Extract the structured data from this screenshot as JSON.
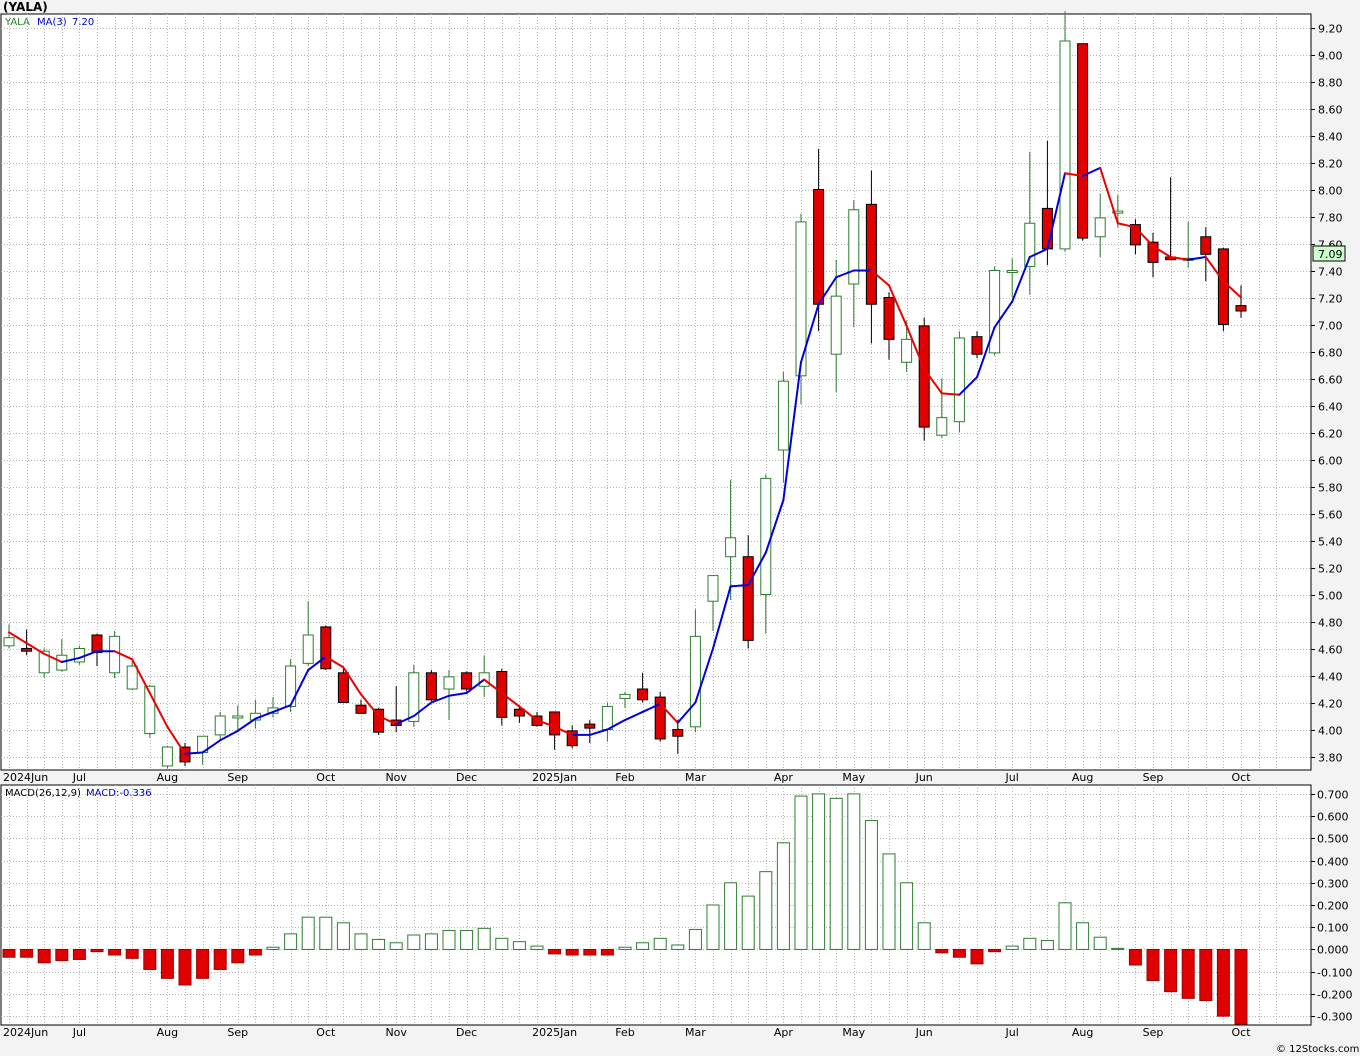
{
  "title": "(YALA)",
  "legend": {
    "symbol": "YALA",
    "ma_label": "MA(3)",
    "ma_value": "7.20",
    "macd_label": "MACD(26,12,9)",
    "macd_value_label": "MACD:-0.336"
  },
  "last_price_label": "7.09",
  "credit": "© 12Stocks.com",
  "colors": {
    "up": "#2e7d32",
    "down": "#e00000",
    "ma_up": "#0000dd",
    "ma_down": "#ee0000",
    "legend_symbol": "#2e7d32",
    "legend_ma": "#0000cc",
    "last_price_box": "#ccffcc"
  },
  "chart_data": [
    {
      "type": "candlestick",
      "title": "(YALA)",
      "ylim": [
        3.7,
        9.3
      ],
      "yticks": [
        3.8,
        4.0,
        4.2,
        4.4,
        4.6,
        4.8,
        5.0,
        5.2,
        5.4,
        5.6,
        5.8,
        6.0,
        6.2,
        6.4,
        6.6,
        6.8,
        7.0,
        7.2,
        7.4,
        7.6,
        7.8,
        8.0,
        8.2,
        8.4,
        8.6,
        8.8,
        9.0,
        9.2
      ],
      "x_labels": [
        "2024Jun",
        "Jul",
        "Aug",
        "Sep",
        "Oct",
        "Nov",
        "Dec",
        "2025Jan",
        "Feb",
        "Mar",
        "Apr",
        "May",
        "Jun",
        "Jul",
        "Aug",
        "Sep",
        "Oct"
      ],
      "x_label_weeks": [
        0,
        4,
        9,
        13,
        18,
        22,
        26,
        31,
        35,
        39,
        44,
        48,
        52,
        57,
        61,
        65,
        70
      ],
      "candles": [
        [
          4.62,
          4.78,
          4.6,
          4.68
        ],
        [
          4.6,
          4.74,
          4.55,
          4.58
        ],
        [
          4.42,
          4.6,
          4.38,
          4.58
        ],
        [
          4.44,
          4.67,
          4.43,
          4.55
        ],
        [
          4.5,
          4.62,
          4.48,
          4.6
        ],
        [
          4.7,
          4.71,
          4.47,
          4.57
        ],
        [
          4.42,
          4.73,
          4.38,
          4.69
        ],
        [
          4.3,
          4.52,
          4.29,
          4.47
        ],
        [
          3.97,
          4.33,
          3.94,
          4.32
        ],
        [
          3.73,
          3.88,
          3.71,
          3.87
        ],
        [
          3.87,
          3.9,
          3.73,
          3.76
        ],
        [
          3.83,
          3.95,
          3.74,
          3.95
        ],
        [
          3.96,
          4.13,
          3.92,
          4.1
        ],
        [
          4.1,
          4.18,
          3.99,
          4.1
        ],
        [
          4.07,
          4.22,
          4.01,
          4.12
        ],
        [
          4.12,
          4.24,
          4.09,
          4.16
        ],
        [
          4.17,
          4.52,
          4.13,
          4.47
        ],
        [
          4.49,
          4.95,
          4.47,
          4.7
        ],
        [
          4.76,
          4.77,
          4.44,
          4.45
        ],
        [
          4.42,
          4.45,
          4.22,
          4.2
        ],
        [
          4.18,
          4.22,
          4.12,
          4.12
        ],
        [
          4.15,
          4.16,
          3.96,
          3.98
        ],
        [
          4.07,
          4.32,
          3.98,
          4.03
        ],
        [
          4.06,
          4.48,
          4.02,
          4.42
        ],
        [
          4.42,
          4.44,
          4.21,
          4.22
        ],
        [
          4.3,
          4.44,
          4.07,
          4.39
        ],
        [
          4.42,
          4.43,
          4.28,
          4.3
        ],
        [
          4.32,
          4.55,
          4.24,
          4.42
        ],
        [
          4.43,
          4.45,
          4.03,
          4.09
        ],
        [
          4.15,
          4.18,
          4.05,
          4.1
        ],
        [
          4.1,
          4.13,
          4.02,
          4.03
        ],
        [
          4.13,
          4.13,
          3.85,
          3.96
        ],
        [
          3.99,
          4.03,
          3.86,
          3.88
        ],
        [
          4.04,
          4.07,
          3.9,
          4.01
        ],
        [
          4.0,
          4.2,
          3.91,
          4.17
        ],
        [
          4.23,
          4.28,
          4.16,
          4.26
        ],
        [
          4.3,
          4.42,
          4.2,
          4.22
        ],
        [
          4.24,
          4.28,
          3.91,
          3.93
        ],
        [
          4.0,
          4.07,
          3.82,
          3.95
        ],
        [
          4.02,
          4.89,
          3.98,
          4.69
        ],
        [
          4.95,
          5.13,
          4.73,
          5.14
        ],
        [
          5.28,
          5.85,
          4.96,
          5.42
        ],
        [
          5.28,
          5.44,
          4.6,
          4.66
        ],
        [
          5.0,
          5.89,
          4.71,
          5.86
        ],
        [
          6.07,
          6.65,
          5.83,
          6.58
        ],
        [
          6.62,
          7.82,
          6.41,
          7.76
        ],
        [
          8.0,
          8.3,
          6.95,
          7.15
        ],
        [
          6.78,
          7.48,
          6.5,
          7.21
        ],
        [
          7.3,
          7.92,
          6.98,
          7.85
        ],
        [
          7.89,
          8.14,
          6.86,
          7.15
        ],
        [
          7.2,
          7.24,
          6.74,
          6.89
        ],
        [
          6.72,
          7.03,
          6.65,
          6.89
        ],
        [
          6.99,
          7.05,
          6.14,
          6.24
        ],
        [
          6.18,
          6.6,
          6.16,
          6.31
        ],
        [
          6.28,
          6.95,
          6.2,
          6.9
        ],
        [
          6.91,
          6.95,
          6.75,
          6.78
        ],
        [
          6.79,
          7.43,
          6.77,
          7.4
        ],
        [
          7.39,
          7.49,
          7.2,
          7.4
        ],
        [
          7.43,
          8.28,
          7.22,
          7.75
        ],
        [
          7.86,
          8.36,
          7.44,
          7.56
        ],
        [
          7.56,
          9.32,
          7.54,
          9.1
        ],
        [
          9.08,
          9.08,
          7.62,
          7.64
        ],
        [
          7.65,
          7.97,
          7.5,
          7.79
        ],
        [
          7.84,
          7.96,
          7.72,
          7.84
        ],
        [
          7.74,
          7.78,
          7.52,
          7.59
        ],
        [
          7.61,
          7.68,
          7.35,
          7.46
        ],
        [
          7.5,
          8.09,
          7.48,
          7.48
        ],
        [
          7.49,
          7.76,
          7.42,
          7.49
        ],
        [
          7.65,
          7.72,
          7.32,
          7.52
        ],
        [
          7.56,
          7.57,
          6.95,
          7.0
        ],
        [
          7.14,
          7.29,
          7.05,
          7.1
        ]
      ],
      "ma3": [
        4.72,
        4.64,
        4.56,
        4.5,
        4.53,
        4.58,
        4.58,
        4.52,
        4.27,
        4.02,
        3.82,
        3.83,
        3.92,
        3.99,
        4.08,
        4.13,
        4.18,
        4.44,
        4.54,
        4.46,
        4.26,
        4.1,
        4.04,
        4.1,
        4.2,
        4.25,
        4.27,
        4.37,
        4.27,
        4.17,
        4.07,
        4.02,
        3.96,
        3.96,
        4.0,
        4.07,
        4.13,
        4.19,
        4.05,
        4.2,
        4.6,
        5.06,
        5.07,
        5.31,
        5.7,
        6.72,
        7.15,
        7.35,
        7.4,
        7.4,
        7.29,
        6.99,
        6.67,
        6.49,
        6.48,
        6.61,
        6.98,
        7.17,
        7.5,
        7.56,
        8.12,
        8.1,
        8.16,
        7.75,
        7.72,
        7.58,
        7.5,
        7.48,
        7.5,
        7.32,
        7.2
      ]
    },
    {
      "type": "bar",
      "title": "MACD(26,12,9)",
      "ylim": [
        -0.34,
        0.74
      ],
      "yticks": [
        -0.3,
        -0.2,
        -0.1,
        0.0,
        0.1,
        0.2,
        0.3,
        0.4,
        0.5,
        0.6,
        0.7
      ],
      "x_labels": [
        "2024Jun",
        "Jul",
        "Aug",
        "Sep",
        "Oct",
        "Nov",
        "Dec",
        "2025Jan",
        "Feb",
        "Mar",
        "Apr",
        "May",
        "Jun",
        "Jul",
        "Aug",
        "Sep",
        "Oct"
      ],
      "values": [
        -0.035,
        -0.035,
        -0.06,
        -0.05,
        -0.045,
        -0.01,
        -0.025,
        -0.04,
        -0.09,
        -0.13,
        -0.16,
        -0.13,
        -0.09,
        -0.06,
        -0.025,
        0.01,
        0.07,
        0.145,
        0.145,
        0.12,
        0.07,
        0.045,
        0.03,
        0.065,
        0.07,
        0.085,
        0.085,
        0.095,
        0.05,
        0.035,
        0.015,
        -0.02,
        -0.025,
        -0.025,
        -0.025,
        0.01,
        0.03,
        0.05,
        0.02,
        0.09,
        0.2,
        0.3,
        0.24,
        0.35,
        0.48,
        0.69,
        0.7,
        0.68,
        0.7,
        0.58,
        0.43,
        0.3,
        0.12,
        -0.015,
        -0.035,
        -0.065,
        -0.01,
        0.015,
        0.05,
        0.04,
        0.21,
        0.12,
        0.055,
        0.005,
        -0.07,
        -0.14,
        -0.19,
        -0.22,
        -0.23,
        -0.3,
        -0.336
      ]
    }
  ]
}
